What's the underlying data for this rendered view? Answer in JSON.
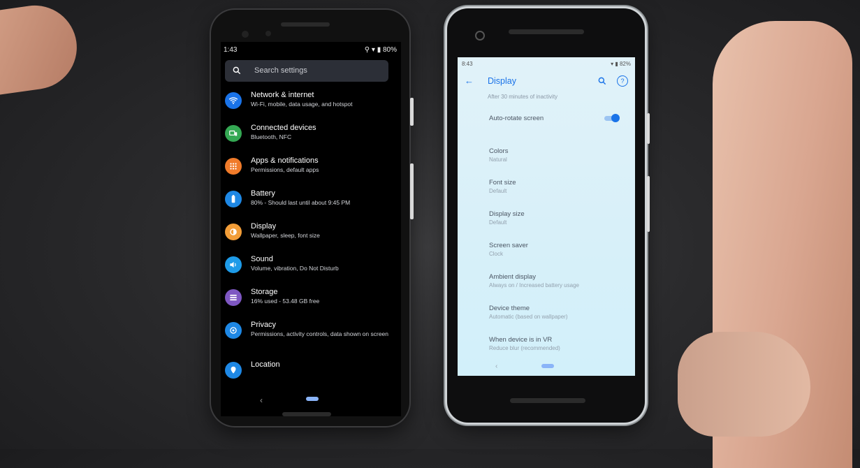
{
  "left_phone": {
    "status": {
      "time": "1:43",
      "battery": "80%"
    },
    "search_placeholder": "Search settings",
    "items": [
      {
        "title": "Network & internet",
        "subtitle": "Wi-Fi, mobile, data usage, and hotspot",
        "color": "#1a73e8",
        "icon": "wifi-icon"
      },
      {
        "title": "Connected devices",
        "subtitle": "Bluetooth, NFC",
        "color": "#34a853",
        "icon": "devices-icon"
      },
      {
        "title": "Apps & notifications",
        "subtitle": "Permissions, default apps",
        "color": "#f07b2a",
        "icon": "apps-grid-icon"
      },
      {
        "title": "Battery",
        "subtitle": "80% - Should last until about 9:45 PM",
        "color": "#1e88e5",
        "icon": "battery-icon"
      },
      {
        "title": "Display",
        "subtitle": "Wallpaper, sleep, font size",
        "color": "#f29d38",
        "icon": "brightness-icon"
      },
      {
        "title": "Sound",
        "subtitle": "Volume, vibration, Do Not Disturb",
        "color": "#1e9be8",
        "icon": "volume-icon"
      },
      {
        "title": "Storage",
        "subtitle": "16% used - 53.48 GB free",
        "color": "#7e57c2",
        "icon": "storage-icon"
      },
      {
        "title": "Privacy",
        "subtitle": "Permissions, activity controls, data shown on screen",
        "color": "#1e88e5",
        "icon": "privacy-icon"
      },
      {
        "title": "Location",
        "subtitle": "",
        "color": "#1e88e5",
        "icon": "location-icon"
      }
    ]
  },
  "right_phone": {
    "status": {
      "time": "8:43",
      "battery": "82%"
    },
    "title": "Display",
    "top_subtitle": "After 30 minutes of inactivity",
    "items": [
      {
        "title": "Auto-rotate screen",
        "subtitle": "",
        "toggle": true
      },
      {
        "title": "Colors",
        "subtitle": "Natural"
      },
      {
        "title": "Font size",
        "subtitle": "Default"
      },
      {
        "title": "Display size",
        "subtitle": "Default"
      },
      {
        "title": "Screen saver",
        "subtitle": "Clock"
      },
      {
        "title": "Ambient display",
        "subtitle": "Always on / Increased battery usage"
      },
      {
        "title": "Device theme",
        "subtitle": "Automatic (based on wallpaper)"
      },
      {
        "title": "When device is in VR",
        "subtitle": "Reduce blur (recommended)"
      }
    ]
  }
}
